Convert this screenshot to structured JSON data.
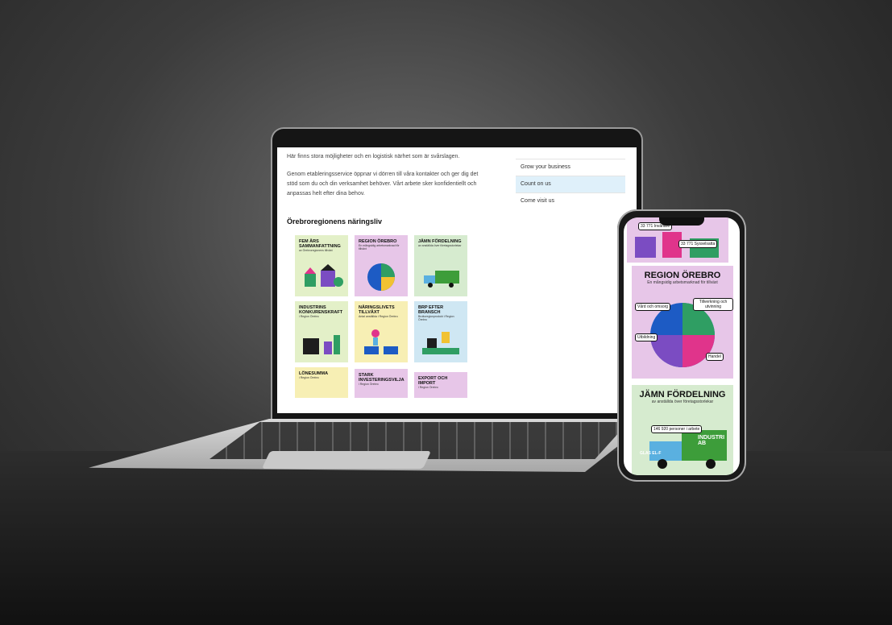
{
  "laptop": {
    "paragraph_top": "Här finns stora möjligheter och en logistisk närhet som är svårslagen.",
    "paragraph_main_1": "Genom etableringsservice öppnar vi dörren till våra kontakter och ger dig det",
    "paragraph_main_2": "stöd som du och din verksamhet behöver. Vårt arbete sker konfidentiellt och",
    "paragraph_main_3": "anpassas helt efter dina behov.",
    "menu": {
      "items": [
        {
          "label": "Grow your business"
        },
        {
          "label": "Count on us"
        },
        {
          "label": "Come visit us"
        }
      ]
    },
    "section_title": "Örebroregionens näringsliv",
    "cards": [
      {
        "title": "FEM ÅRS SAMMANFATTNING",
        "sub": "av Örebroregionens tillväxt",
        "color": "#e3f0c8"
      },
      {
        "title": "REGION ÖREBRO",
        "sub": "En mångsidig arbetsmarknad för tillväxt",
        "color": "#e7c6e8"
      },
      {
        "title": "JÄMN FÖRDELNING",
        "sub": "av anställda över företagsstorlekar",
        "color": "#d6ebcf"
      },
      {
        "title": "INDUSTRINS KONKURENSKRAFT",
        "sub": "i Region Örebro",
        "color": "#e3f0c8"
      },
      {
        "title": "NÄRINGSLIVETS TILLVÄXT",
        "sub": "Antal anställda i Region Örebro",
        "color": "#f7efb4"
      },
      {
        "title": "BRP EFTER BRANSCH",
        "sub": "Bruttoregionprodukt i Region Örebro",
        "color": "#cfe7f3"
      },
      {
        "title": "LÖNESUMMA",
        "sub": "i Region Örebro",
        "color": "#f7efb4"
      },
      {
        "title": "STARK INVESTERINGSVILJA",
        "sub": "i Region Örebro",
        "color": "#e7c6e8"
      },
      {
        "title": "EXPORT OCH IMPORT",
        "sub": "i Region Örebro",
        "color": "#e7c6e8"
      }
    ]
  },
  "phone": {
    "top_card": {
      "label1": "33 771 Invånare",
      "label2": "33 771 Sysselsatta"
    },
    "region_card": {
      "title": "REGION ÖREBRO",
      "sub": "En mångsidig arbetsmarknad för tillväxt",
      "labels": {
        "vard": "Vård och omsorg",
        "tillverkning": "Tillverkning och utvinning",
        "utbildning": "Utbildning",
        "handel": "Handel"
      }
    },
    "fordelning_card": {
      "title": "JÄMN FÖRDELNING",
      "sub": "av anställda över företagsstorlekar",
      "persons": "146 920 personer i arbete",
      "truck": "INDUSTRI AB",
      "glas": "GLAS EL-F"
    }
  }
}
